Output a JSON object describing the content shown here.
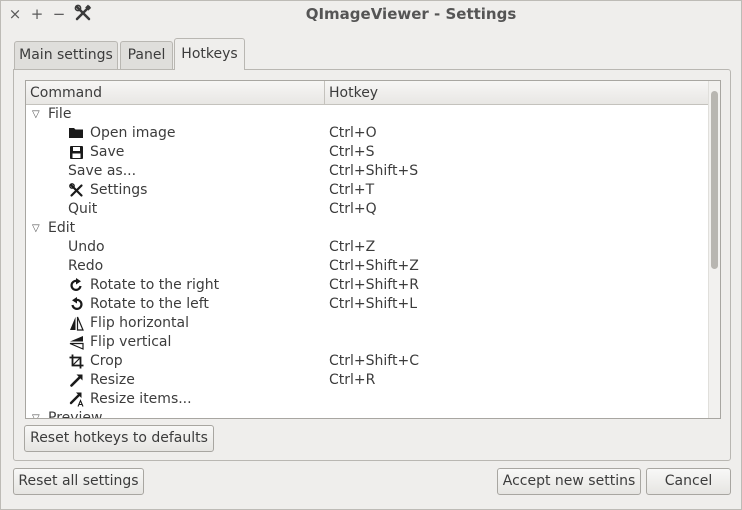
{
  "window": {
    "title": "QImageViewer - Settings",
    "controls": {
      "close": "×",
      "maximize": "+",
      "minimize": "−"
    }
  },
  "tabs": [
    {
      "label": "Main settings",
      "active": false
    },
    {
      "label": "Panel",
      "active": false
    },
    {
      "label": "Hotkeys",
      "active": true
    }
  ],
  "tree": {
    "columns": {
      "command": "Command",
      "hotkey": "Hotkey"
    },
    "categories": {
      "file": "File",
      "edit": "Edit",
      "preview": "Preview"
    },
    "items": {
      "open_image": {
        "label": "Open image",
        "hotkey": "Ctrl+O",
        "icon": "folder-icon"
      },
      "save": {
        "label": "Save",
        "hotkey": "Ctrl+S",
        "icon": "floppy-icon"
      },
      "save_as": {
        "label": "Save as...",
        "hotkey": "Ctrl+Shift+S"
      },
      "settings": {
        "label": "Settings",
        "hotkey": "Ctrl+T",
        "icon": "tools-icon"
      },
      "quit": {
        "label": "Quit",
        "hotkey": "Ctrl+Q"
      },
      "undo": {
        "label": "Undo",
        "hotkey": "Ctrl+Z"
      },
      "redo": {
        "label": "Redo",
        "hotkey": "Ctrl+Shift+Z"
      },
      "rotate_right": {
        "label": "Rotate to the right",
        "hotkey": "Ctrl+Shift+R",
        "icon": "rotate-right-icon"
      },
      "rotate_left": {
        "label": "Rotate to the left",
        "hotkey": "Ctrl+Shift+L",
        "icon": "rotate-left-icon"
      },
      "flip_h": {
        "label": "Flip horizontal",
        "hotkey": "",
        "icon": "flip-horizontal-icon"
      },
      "flip_v": {
        "label": "Flip vertical",
        "hotkey": "",
        "icon": "flip-vertical-icon"
      },
      "crop": {
        "label": "Crop",
        "hotkey": "Ctrl+Shift+C",
        "icon": "crop-icon"
      },
      "resize": {
        "label": "Resize",
        "hotkey": "Ctrl+R",
        "icon": "resize-icon"
      },
      "resize_items": {
        "label": "Resize items...",
        "hotkey": "",
        "icon": "resize-items-icon"
      }
    }
  },
  "buttons": {
    "reset_hotkeys": "Reset hotkeys to defaults",
    "reset_all": "Reset all settings",
    "accept": "Accept new settins",
    "cancel": "Cancel"
  }
}
